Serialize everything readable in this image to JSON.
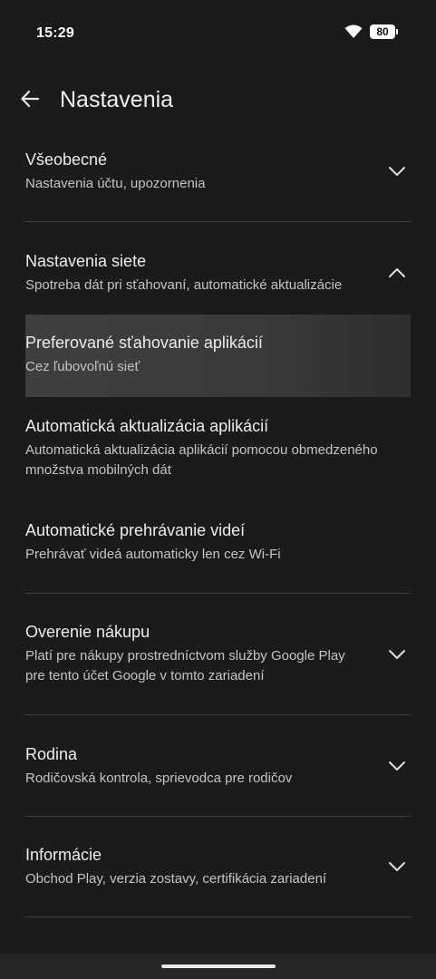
{
  "status_bar": {
    "time": "15:29",
    "battery": "80",
    "wifi_icon": "wifi-icon"
  },
  "header": {
    "title": "Nastavenia",
    "back_icon": "arrow-back-icon"
  },
  "sections": {
    "general": {
      "title": "Všeobecné",
      "subtitle": "Nastavenia účtu, upozornenia",
      "expanded": false
    },
    "network": {
      "title": "Nastavenia siete",
      "subtitle": "Spotreba dát pri sťahovaní, automatické aktualizácie",
      "expanded": true,
      "items": [
        {
          "title": "Preferované sťahovanie aplikácií",
          "subtitle": "Cez ľubovoľnú sieť"
        },
        {
          "title": "Automatická aktualizácia aplikácií",
          "subtitle_line1": "Automatická aktualizácia aplikácií pomocou obmedzeného",
          "subtitle_line2": "množstva mobilných dát"
        },
        {
          "title": "Automatické prehrávanie videí",
          "subtitle": "Prehrávať videá automaticky len cez Wi-Fi"
        }
      ]
    },
    "purchase": {
      "title": "Overenie nákupu",
      "subtitle_line1": "Platí pre nákupy prostredníctvom služby Google Play",
      "subtitle_line2": "pre tento účet Google v tomto zariadení",
      "expanded": false
    },
    "family": {
      "title": "Rodina",
      "subtitle": "Rodičovská kontrola, sprievodca pre rodičov",
      "expanded": false
    },
    "about": {
      "title": "Informácie",
      "subtitle": "Obchod Play, verzia zostavy, certifikácia zariadení",
      "expanded": false
    }
  },
  "colors": {
    "background": "#1b1b1b",
    "text_primary": "#ececec",
    "text_secondary": "#c4c4c4",
    "divider": "#3d3d3d",
    "highlight": "#3c3c3c"
  }
}
